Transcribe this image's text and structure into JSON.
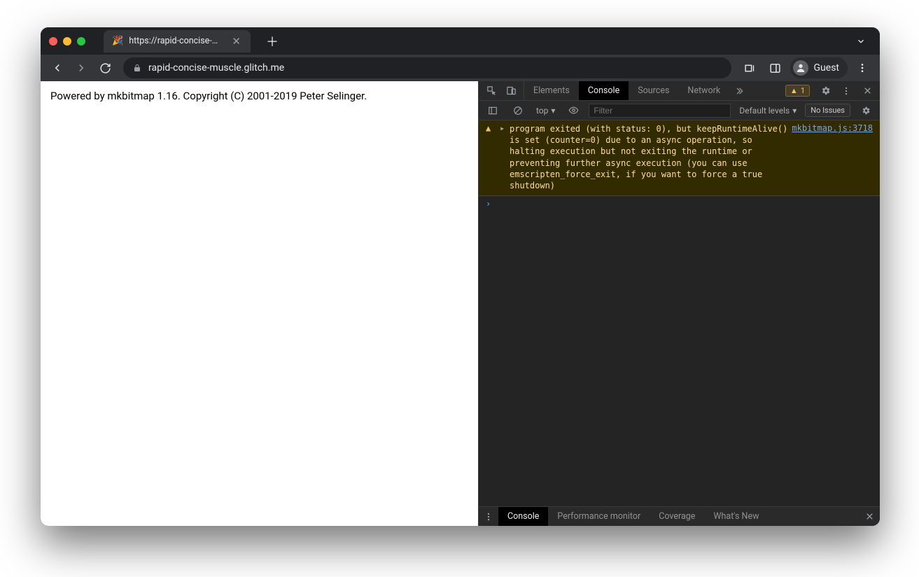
{
  "window": {
    "tab_title": "https://rapid-concise-muscle.g",
    "tab_favicon": "🎉"
  },
  "toolbar": {
    "url": "rapid-concise-muscle.glitch.me",
    "profile_label": "Guest"
  },
  "page": {
    "body_text": "Powered by mkbitmap 1.16. Copyright (C) 2001-2019 Peter Selinger."
  },
  "devtools": {
    "tabs": {
      "elements": "Elements",
      "console": "Console",
      "sources": "Sources",
      "network": "Network"
    },
    "warning_count": "1",
    "filter": {
      "context": "top",
      "placeholder": "Filter",
      "levels": "Default levels",
      "issues": "No Issues"
    },
    "log": {
      "message": "program exited (with status: 0), but keepRuntimeAlive() is set (counter=0) due to an async operation, so halting execution but not exiting the runtime or preventing further async execution (you can use emscripten_force_exit, if you want to force a true shutdown)",
      "source": "mkbitmap.js:3718"
    },
    "drawer": {
      "console": "Console",
      "perf": "Performance monitor",
      "coverage": "Coverage",
      "whatsnew": "What's New"
    }
  }
}
